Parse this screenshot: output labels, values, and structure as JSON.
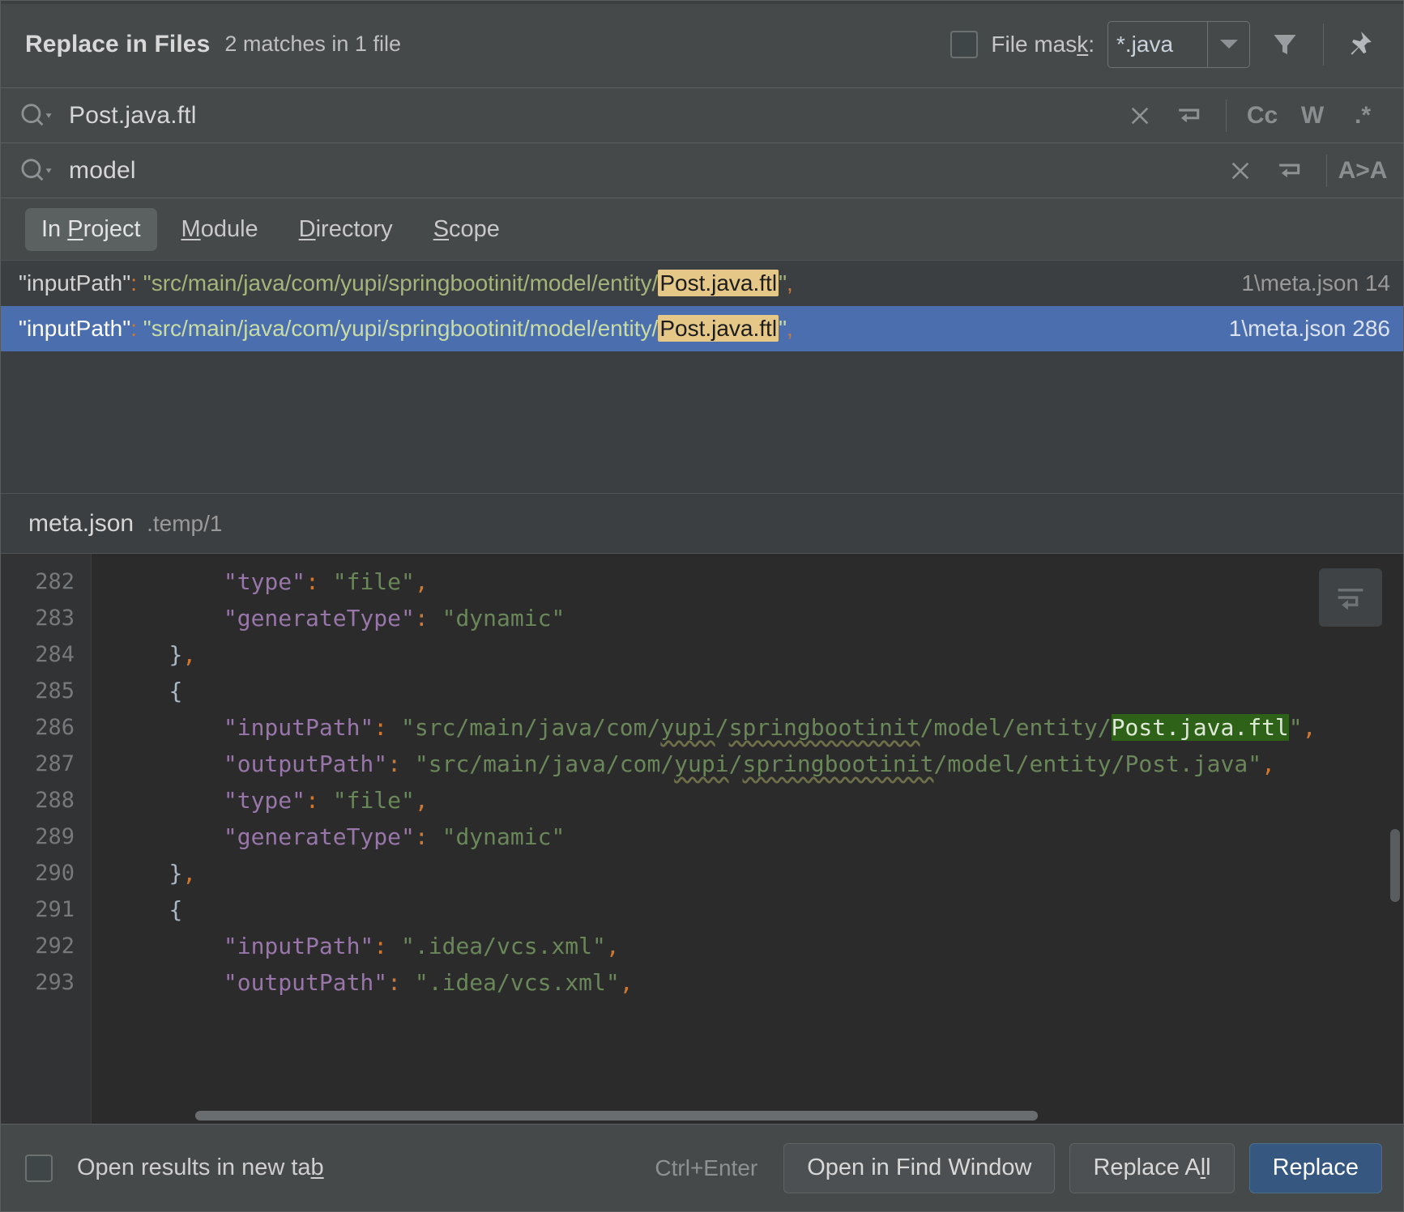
{
  "header": {
    "title": "Replace in Files",
    "subtitle": "2 matches in 1 file",
    "file_mask_label_pre": "File mas",
    "file_mask_label_accel": "k",
    "file_mask_label_post": ":",
    "file_mask_value": "*.java",
    "filter_icon": "filter-funnel-icon",
    "pin_icon": "pin-icon"
  },
  "search": {
    "value": "Post.java.ftl",
    "icons": [
      "clear-icon",
      "history-return-icon",
      "match-case-icon",
      "words-icon",
      "regex-icon"
    ],
    "match_case_label": "Cc",
    "words_label": "W",
    "regex_label": ".*"
  },
  "replace": {
    "value": "model",
    "icons": [
      "clear-icon",
      "history-return-icon",
      "preserve-case-icon"
    ],
    "preserve_case_label": "A˃A"
  },
  "scope_tabs": [
    {
      "pre": "In ",
      "accel": "P",
      "post": "roject",
      "active": true
    },
    {
      "pre": "",
      "accel": "M",
      "post": "odule",
      "active": false
    },
    {
      "pre": "",
      "accel": "D",
      "post": "irectory",
      "active": false
    },
    {
      "pre": "",
      "accel": "S",
      "post": "cope",
      "active": false
    }
  ],
  "results": [
    {
      "prefix_key": "\"inputPath\"",
      "colon": ": ",
      "path_before": "\"src/main/java/com/yupi/springbootinit/model/entity/",
      "match": "Post.java.ftl",
      "path_after": "\"",
      "trailing": ",",
      "file": "1\\meta.json 14",
      "selected": false
    },
    {
      "prefix_key": "\"inputPath\"",
      "colon": ": ",
      "path_before": "\"src/main/java/com/yupi/springbootinit/model/entity/",
      "match": "Post.java.ftl",
      "path_after": "\"",
      "trailing": ",",
      "file": "1\\meta.json 286",
      "selected": true
    }
  ],
  "preview": {
    "file_name": "meta.json",
    "file_path": ".temp/1",
    "toggle_icon": "wrap-lines-icon",
    "lines": [
      {
        "num": "282",
        "indent": 2,
        "segments": [
          {
            "t": "\"type\"",
            "c": "k"
          },
          {
            "t": ": ",
            "c": "c"
          },
          {
            "t": "\"file\"",
            "c": "s"
          },
          {
            "t": ",",
            "c": "c"
          }
        ]
      },
      {
        "num": "283",
        "indent": 2,
        "segments": [
          {
            "t": "\"generateType\"",
            "c": "k"
          },
          {
            "t": ": ",
            "c": "c"
          },
          {
            "t": "\"dynamic\"",
            "c": "s"
          }
        ]
      },
      {
        "num": "284",
        "indent": 1,
        "segments": [
          {
            "t": "}",
            "c": "b"
          },
          {
            "t": ",",
            "c": "c"
          }
        ]
      },
      {
        "num": "285",
        "indent": 1,
        "segments": [
          {
            "t": "{",
            "c": "b"
          }
        ]
      },
      {
        "num": "286",
        "indent": 2,
        "segments": [
          {
            "t": "\"inputPath\"",
            "c": "k"
          },
          {
            "t": ": ",
            "c": "c"
          },
          {
            "t": "\"src/main/java/com/",
            "c": "s"
          },
          {
            "t": "yupi",
            "c": "sq"
          },
          {
            "t": "/",
            "c": "s"
          },
          {
            "t": "springbootinit",
            "c": "sq"
          },
          {
            "t": "/model/entity/",
            "c": "s"
          },
          {
            "t": "Post.java.ftl",
            "c": "ghl"
          },
          {
            "t": "\"",
            "c": "s"
          },
          {
            "t": ",",
            "c": "c"
          }
        ]
      },
      {
        "num": "287",
        "indent": 2,
        "segments": [
          {
            "t": "\"outputPath\"",
            "c": "k"
          },
          {
            "t": ": ",
            "c": "c"
          },
          {
            "t": "\"src/main/java/com/",
            "c": "s"
          },
          {
            "t": "yupi",
            "c": "sq"
          },
          {
            "t": "/",
            "c": "s"
          },
          {
            "t": "springbootinit",
            "c": "sq"
          },
          {
            "t": "/model/entity/Post.java\"",
            "c": "s"
          },
          {
            "t": ",",
            "c": "c"
          }
        ]
      },
      {
        "num": "288",
        "indent": 2,
        "segments": [
          {
            "t": "\"type\"",
            "c": "k"
          },
          {
            "t": ": ",
            "c": "c"
          },
          {
            "t": "\"file\"",
            "c": "s"
          },
          {
            "t": ",",
            "c": "c"
          }
        ]
      },
      {
        "num": "289",
        "indent": 2,
        "segments": [
          {
            "t": "\"generateType\"",
            "c": "k"
          },
          {
            "t": ": ",
            "c": "c"
          },
          {
            "t": "\"dynamic\"",
            "c": "s"
          }
        ]
      },
      {
        "num": "290",
        "indent": 1,
        "segments": [
          {
            "t": "}",
            "c": "b"
          },
          {
            "t": ",",
            "c": "c"
          }
        ]
      },
      {
        "num": "291",
        "indent": 1,
        "segments": [
          {
            "t": "{",
            "c": "b"
          }
        ]
      },
      {
        "num": "292",
        "indent": 2,
        "segments": [
          {
            "t": "\"inputPath\"",
            "c": "k"
          },
          {
            "t": ": ",
            "c": "c"
          },
          {
            "t": "\".idea/vcs.xml\"",
            "c": "s"
          },
          {
            "t": ",",
            "c": "c"
          }
        ]
      },
      {
        "num": "293",
        "indent": 2,
        "segments": [
          {
            "t": "\"outputPath\"",
            "c": "k"
          },
          {
            "t": ": ",
            "c": "c"
          },
          {
            "t": "\".idea/vcs.xml\"",
            "c": "s"
          },
          {
            "t": ",",
            "c": "c"
          }
        ]
      }
    ]
  },
  "footer": {
    "open_new_tab_pre": "Open results in new ta",
    "open_new_tab_accel": "b",
    "shortcut": "Ctrl+Enter",
    "open_find_window": "Open in Find Window",
    "replace_all_pre": "Replace A",
    "replace_all_accel": "l",
    "replace_all_post": "l",
    "replace": "Replace"
  },
  "colors": {
    "dialog_bg": "#45494a",
    "results_bg": "#3c3f41",
    "editor_bg": "#2b2b2b",
    "selection_blue": "#4b6eaf",
    "match_highlight": "#e5c887",
    "editor_match_highlight": "#2d6218",
    "primary_button": "#365880"
  }
}
